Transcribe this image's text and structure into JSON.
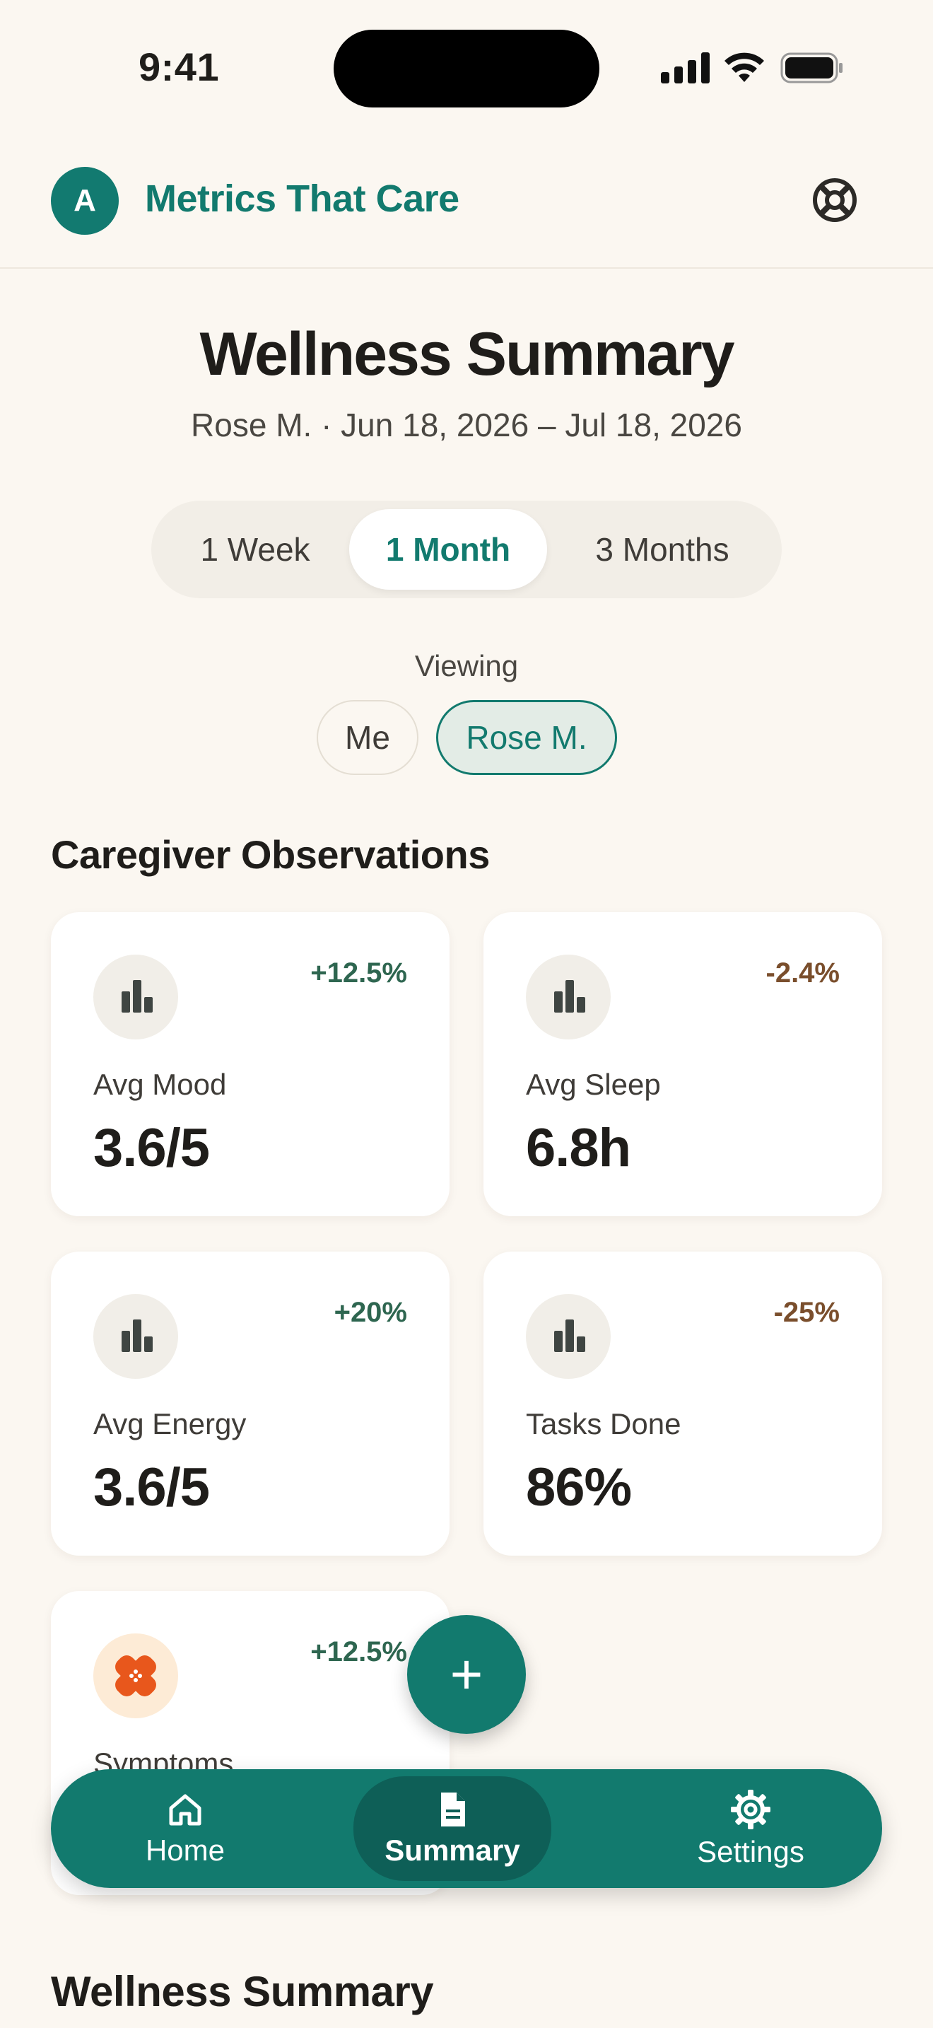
{
  "status_bar": {
    "time": "9:41"
  },
  "header": {
    "avatar_initial": "A",
    "app_title": "Metrics That Care",
    "help_icon": "lifebuoy-icon"
  },
  "page": {
    "title": "Wellness Summary",
    "subtitle": "Rose M. · Jun 18, 2026 – Jul 18, 2026"
  },
  "range_tabs": [
    {
      "label": "1 Week",
      "active": false
    },
    {
      "label": "1 Month",
      "active": true
    },
    {
      "label": "3 Months",
      "active": false
    }
  ],
  "viewing": {
    "label": "Viewing",
    "options": [
      {
        "label": "Me",
        "active": false
      },
      {
        "label": "Rose M.",
        "active": true
      }
    ]
  },
  "caregiver_section": {
    "title": "Caregiver Observations"
  },
  "cards": [
    {
      "icon": "bar-chart-icon",
      "label": "Avg Mood",
      "value": "3.6/5",
      "delta": "+12.5%",
      "trend": "positive"
    },
    {
      "icon": "bar-chart-icon",
      "label": "Avg Sleep",
      "value": "6.8h",
      "delta": "-2.4%",
      "trend": "negative"
    },
    {
      "icon": "bar-chart-icon",
      "label": "Avg Energy",
      "value": "3.6/5",
      "delta": "+20%",
      "trend": "positive"
    },
    {
      "icon": "bar-chart-icon",
      "label": "Tasks Done",
      "value": "86%",
      "delta": "-25%",
      "trend": "negative"
    },
    {
      "icon": "bandage-icon",
      "label": "Symptoms",
      "value": "",
      "delta": "+12.5%",
      "trend": "positive"
    }
  ],
  "fab": {
    "label": "+"
  },
  "nav": [
    {
      "icon": "home-icon",
      "label": "Home",
      "active": false
    },
    {
      "icon": "document-icon",
      "label": "Summary",
      "active": true
    },
    {
      "icon": "gear-icon",
      "label": "Settings",
      "active": false
    }
  ],
  "wellness_section": {
    "title": "Wellness Summary"
  },
  "colors": {
    "accent": "#127A6E",
    "background": "#FBF7F1",
    "positive": "#2E6650",
    "negative": "#7A4E2C"
  }
}
